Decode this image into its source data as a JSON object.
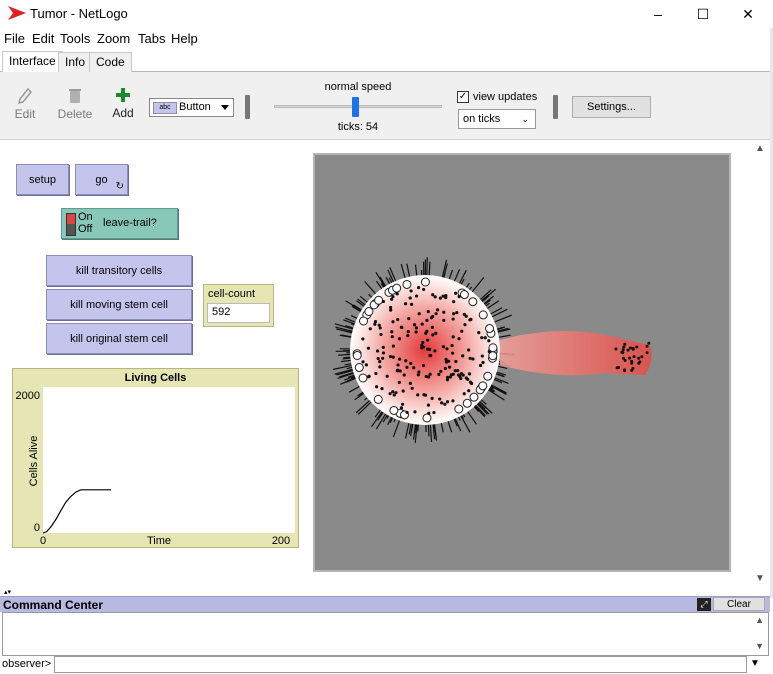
{
  "window": {
    "title": "Tumor - NetLogo",
    "minimize_glyph": "–",
    "maximize_glyph": "☐",
    "close_glyph": "✕"
  },
  "menu": [
    "File",
    "Edit",
    "Tools",
    "Zoom",
    "Tabs",
    "Help"
  ],
  "tabs": [
    {
      "label": "Interface",
      "active": true
    },
    {
      "label": "Info",
      "active": false
    },
    {
      "label": "Code",
      "active": false
    }
  ],
  "toolbar": {
    "edit_label": "Edit",
    "delete_label": "Delete",
    "add_label": "Add",
    "widget_type": "Button",
    "speed_label": "normal speed",
    "ticks_label": "ticks: 54",
    "view_updates_label": "view updates",
    "view_updates_checked": true,
    "update_mode": "on ticks",
    "settings_label": "Settings..."
  },
  "widgets": {
    "setup_label": "setup",
    "go_label": "go",
    "switch": {
      "on": "On",
      "off": "Off",
      "label": "leave-trail?"
    },
    "kill_transitory_label": "kill transitory cells",
    "kill_moving_label": "kill moving stem cell",
    "kill_original_label": "kill original stem cell",
    "monitor": {
      "label": "cell-count",
      "value": "592"
    }
  },
  "plot": {
    "title": "Living Cells",
    "ylabel": "Cells Alive",
    "xlabel": "Time",
    "ymax_label": "2000",
    "ymin_label": "0",
    "xmin_label": "0",
    "xmax_label": "200"
  },
  "chart_data": {
    "type": "line",
    "title": "Living Cells",
    "xlabel": "Time",
    "ylabel": "Cells Alive",
    "xlim": [
      0,
      200
    ],
    "ylim": [
      0,
      2000
    ],
    "series": [
      {
        "x": [
          0,
          3,
          6,
          10,
          14,
          18,
          22,
          26,
          30,
          54
        ],
        "values": [
          0,
          20,
          80,
          180,
          300,
          420,
          500,
          560,
          592,
          592
        ]
      }
    ]
  },
  "command_center": {
    "title": "Command Center",
    "clear_label": "Clear",
    "prompt": "observer>",
    "input_value": ""
  },
  "colors": {
    "button_bg": "#c4c4ec",
    "monitor_bg": "#e6e6b4",
    "view_bg": "#8a8a8a",
    "tumor": "#e8504a"
  }
}
